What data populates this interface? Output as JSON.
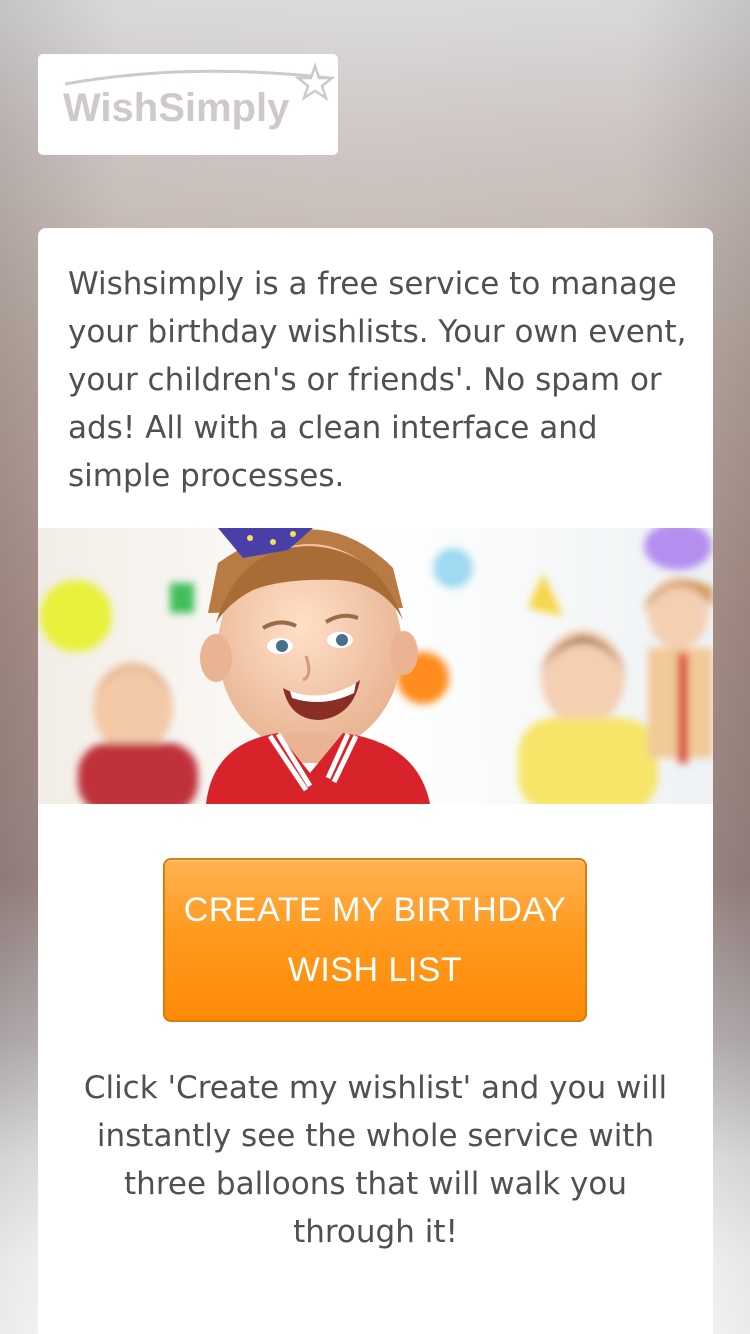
{
  "logo": {
    "text": "WishSimply"
  },
  "intro": {
    "text": "Wishsimply is a free service to manage your birthday wishlists. Your own event, your children's or friends'. No spam or ads! All with a clean interface and simple processes."
  },
  "hero": {
    "icon": "birthday-party-photo"
  },
  "cta": {
    "label": "CREATE MY BIRTHDAY WISH LIST"
  },
  "note": {
    "text": "Click 'Create my wishlist' and you will instantly see the whole service with three balloons that will walk you through it!"
  },
  "colors": {
    "accent": "#ff9410",
    "text": "#505050",
    "logo": "#cfc9c9"
  }
}
